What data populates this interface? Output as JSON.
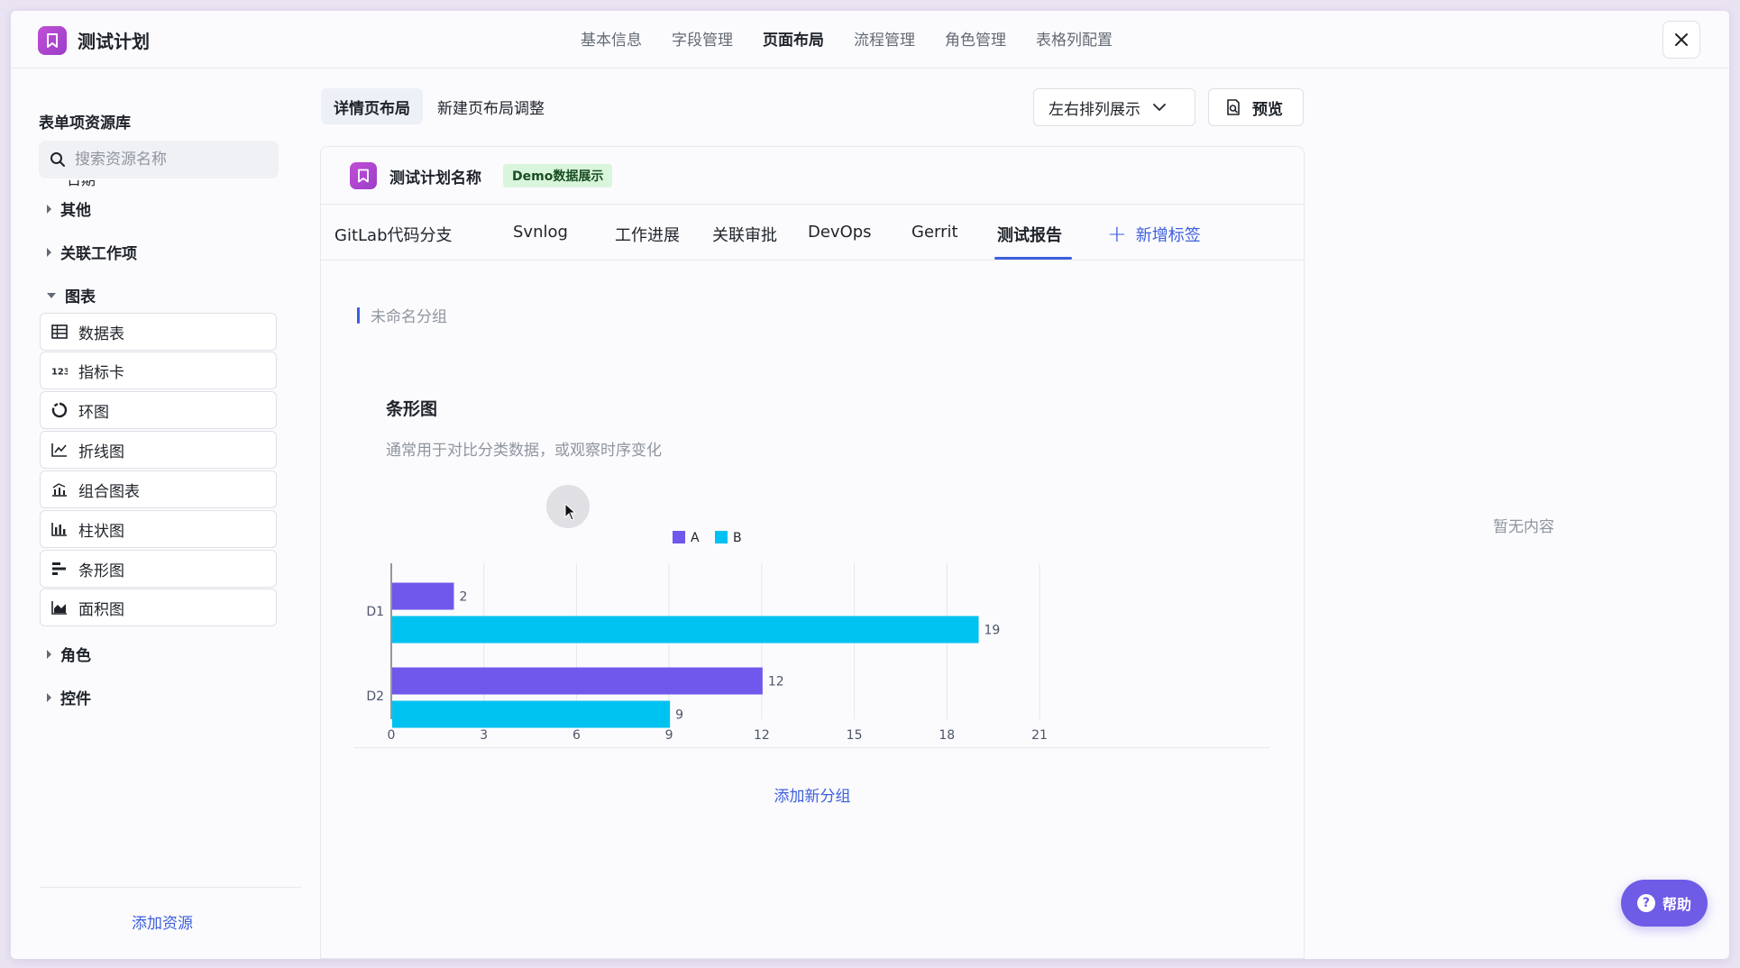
{
  "app": {
    "title": "测试计划"
  },
  "top_nav": [
    "基本信息",
    "字段管理",
    "页面布局",
    "流程管理",
    "角色管理",
    "表格列配置"
  ],
  "top_nav_active": 2,
  "sidebar": {
    "title": "表单项资源库",
    "search_placeholder": "搜索资源名称",
    "partial_item": "日期",
    "groups": {
      "other": "其他",
      "related": "关联工作项",
      "charts": "图表",
      "role": "角色",
      "controls": "控件"
    },
    "chart_items": [
      {
        "label": "数据表",
        "icon": "table-icon"
      },
      {
        "label": "指标卡",
        "icon": "number-icon"
      },
      {
        "label": "环图",
        "icon": "donut-icon"
      },
      {
        "label": "折线图",
        "icon": "line-chart-icon"
      },
      {
        "label": "组合图表",
        "icon": "combo-chart-icon"
      },
      {
        "label": "柱状图",
        "icon": "bar-chart-icon"
      },
      {
        "label": "条形图",
        "icon": "horizontal-bar-icon"
      },
      {
        "label": "面积图",
        "icon": "area-chart-icon"
      }
    ],
    "add_resource": "添加资源"
  },
  "layout_tabs": [
    "详情页布局",
    "新建页布局调整"
  ],
  "arrange_select": "左右排列展示",
  "preview": "预览",
  "card": {
    "title": "测试计划名称",
    "badge": "Demo数据展示",
    "tabs": [
      "GitLab代码分支",
      "Svnlog",
      "工作进展",
      "关联审批",
      "DevOps",
      "Gerrit",
      "测试报告"
    ],
    "active_tab": 6,
    "add_tab": "新增标签",
    "group_label": "未命名分组",
    "chart_title": "条形图",
    "chart_subtitle": "通常用于对比分类数据，或观察时序变化",
    "add_group": "添加新分组"
  },
  "right_panel": {
    "empty": "暂无内容"
  },
  "help": "帮助",
  "colors": {
    "accent": "#3d5fdc",
    "series_a": "#7058ec",
    "series_b": "#00c2f0",
    "help_bg": "#6e5ce6"
  },
  "chart_data": {
    "type": "bar",
    "orientation": "horizontal",
    "categories": [
      "D1",
      "D2"
    ],
    "series": [
      {
        "name": "A",
        "values": [
          2,
          12
        ]
      },
      {
        "name": "B",
        "values": [
          19,
          9
        ]
      }
    ],
    "xlim": [
      0,
      21
    ],
    "xticks": [
      0,
      3,
      6,
      9,
      12,
      15,
      18,
      21
    ],
    "legend": "top-center",
    "grid": true
  }
}
